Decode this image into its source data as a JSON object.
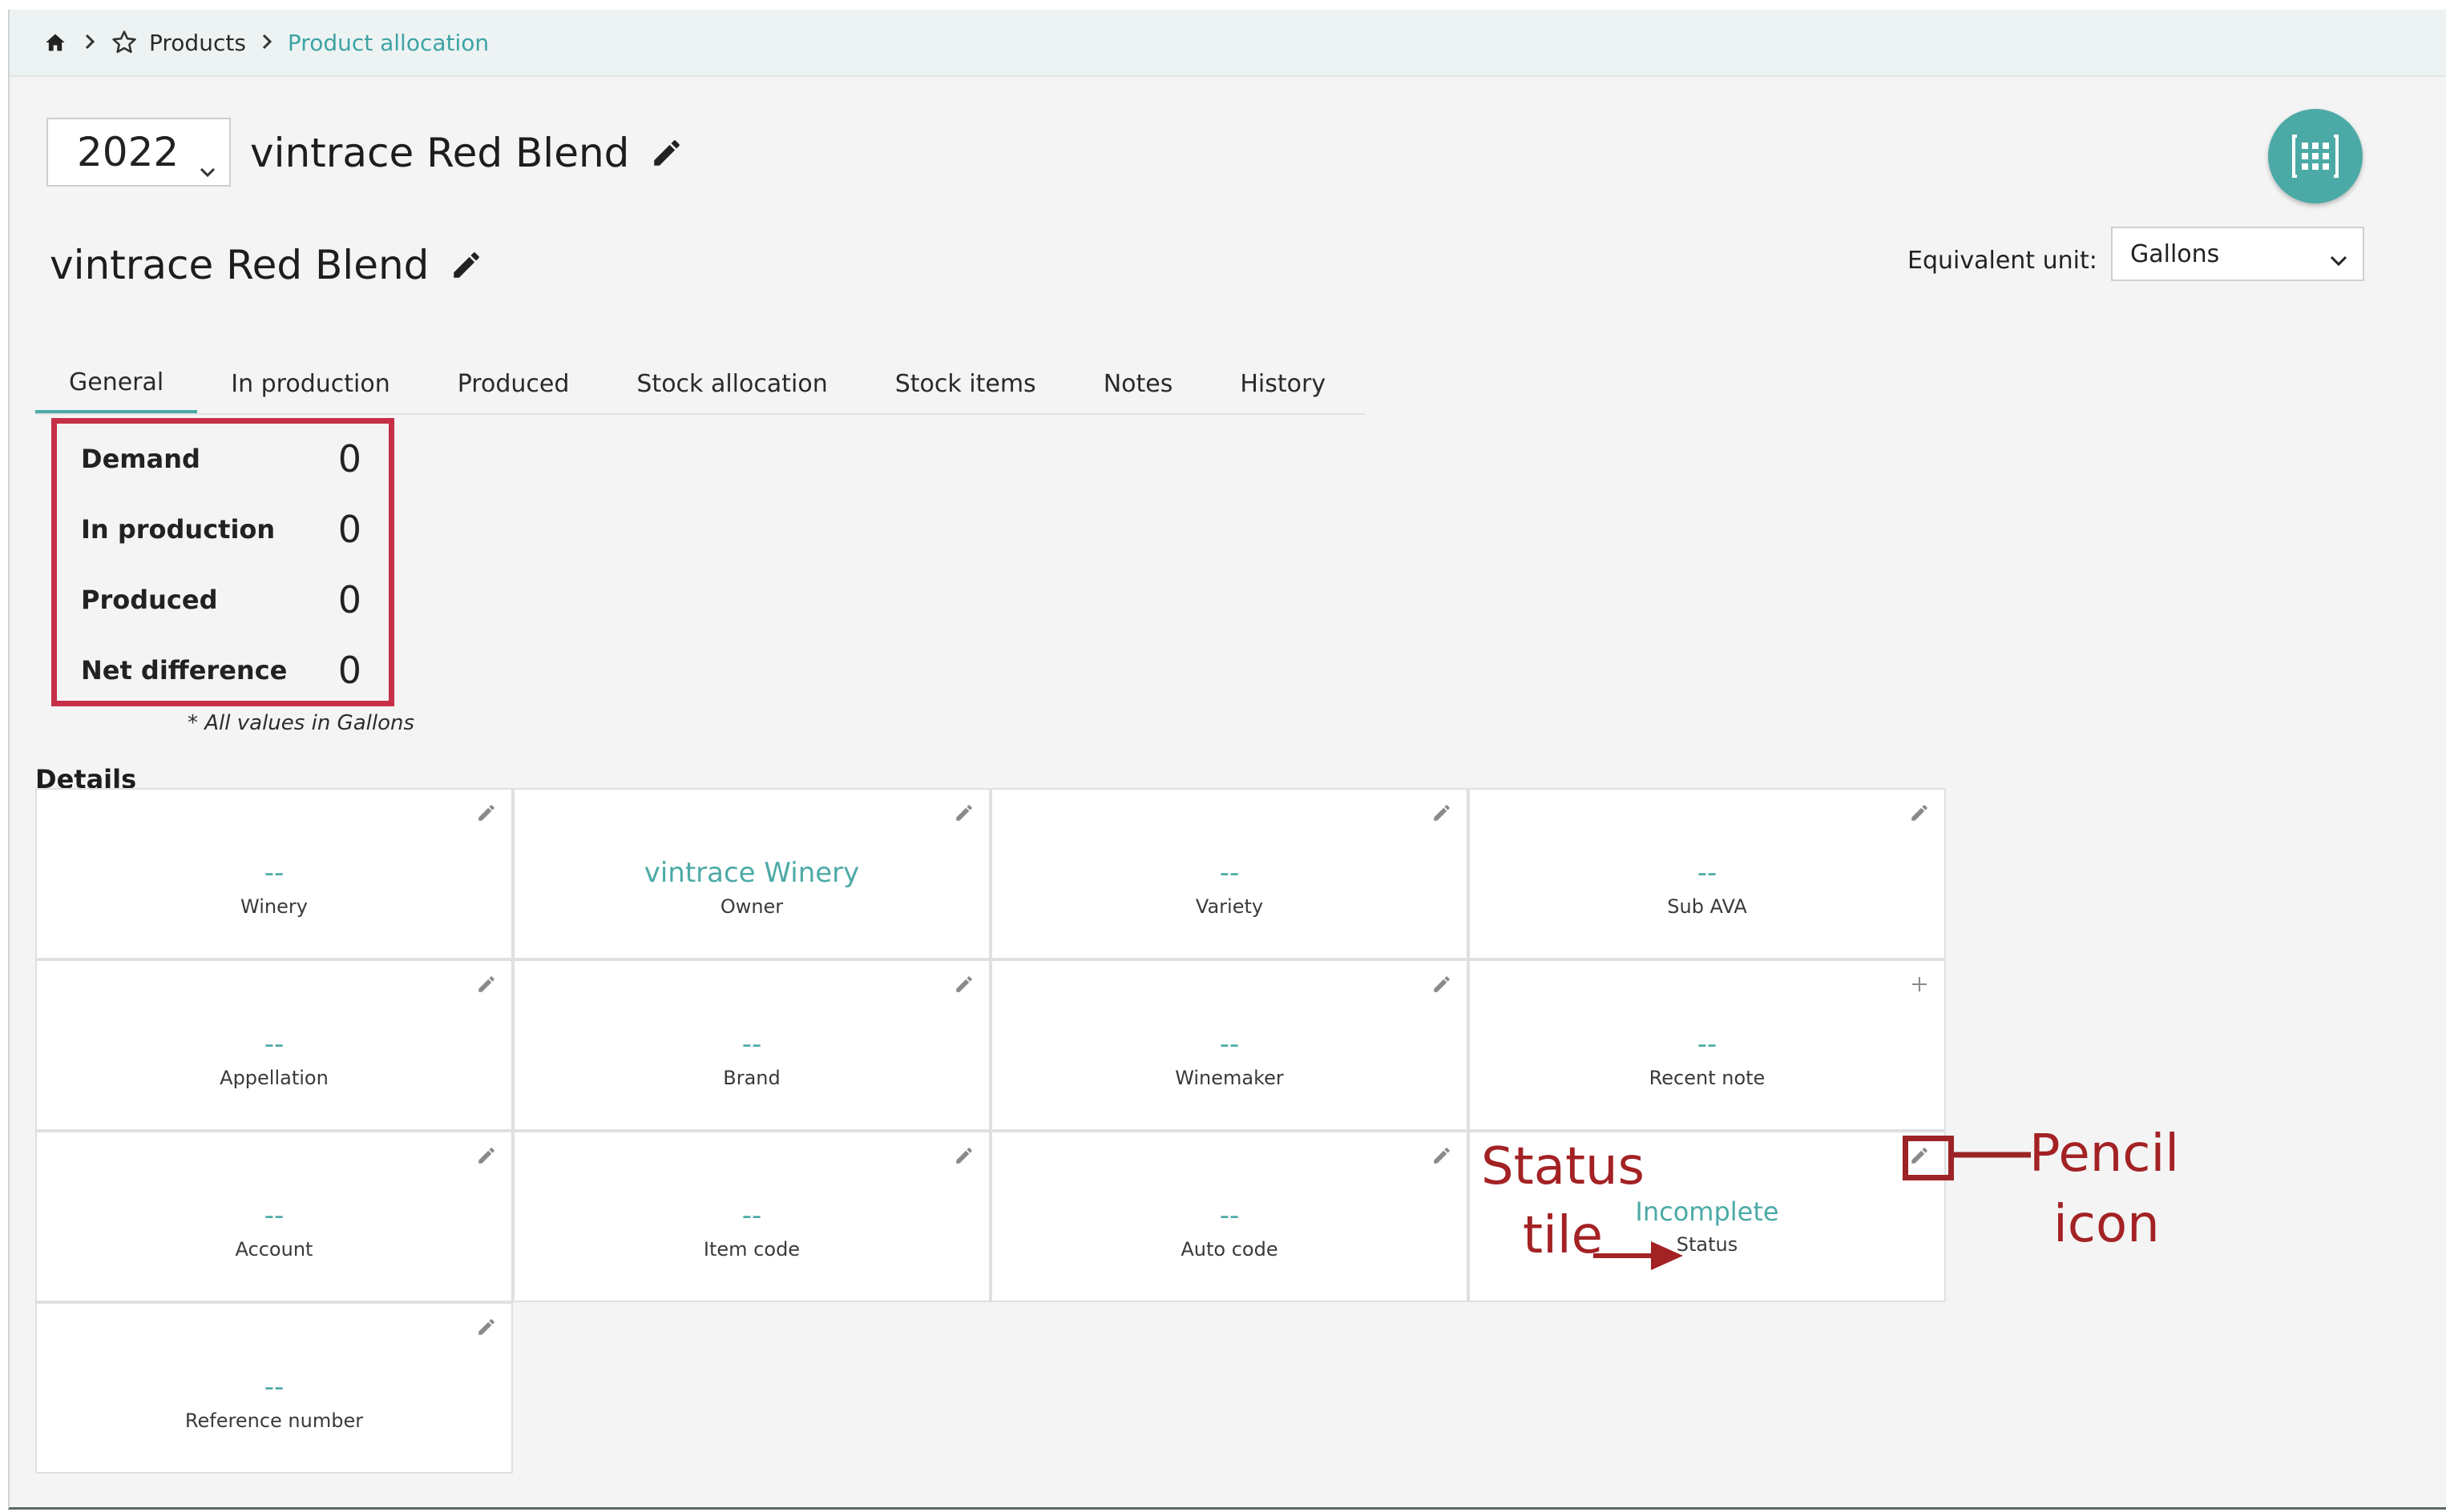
{
  "breadcrumb": {
    "home_icon": "home-icon",
    "star_icon": "star-icon",
    "items": [
      "Products",
      "Product allocation"
    ]
  },
  "header": {
    "year": "2022",
    "title": "vintrace Red Blend",
    "subtitle": "vintrace Red Blend"
  },
  "equivalent_unit": {
    "label": "Equivalent unit:",
    "value": "Gallons"
  },
  "tabs": [
    "General",
    "In production",
    "Produced",
    "Stock allocation",
    "Stock items",
    "Notes",
    "History"
  ],
  "active_tab": "General",
  "summary": {
    "rows": [
      {
        "label": "Demand",
        "value": "0"
      },
      {
        "label": "In production",
        "value": "0"
      },
      {
        "label": "Produced",
        "value": "0"
      },
      {
        "label": "Net difference",
        "value": "0"
      }
    ],
    "note": "* All values in Gallons"
  },
  "details": {
    "heading": "Details",
    "tiles": [
      {
        "value": "--",
        "label": "Winery",
        "action": "edit"
      },
      {
        "value": "vintrace Winery",
        "label": "Owner",
        "action": "edit"
      },
      {
        "value": "--",
        "label": "Variety",
        "action": "edit"
      },
      {
        "value": "--",
        "label": "Sub AVA",
        "action": "edit"
      },
      {
        "value": "--",
        "label": "Appellation",
        "action": "edit"
      },
      {
        "value": "--",
        "label": "Brand",
        "action": "edit"
      },
      {
        "value": "--",
        "label": "Winemaker",
        "action": "edit"
      },
      {
        "value": "--",
        "label": "Recent note",
        "action": "add"
      },
      {
        "value": "--",
        "label": "Account",
        "action": "edit"
      },
      {
        "value": "--",
        "label": "Item code",
        "action": "edit"
      },
      {
        "value": "--",
        "label": "Auto code",
        "action": "edit"
      },
      {
        "value": "Incomplete",
        "label": "Status",
        "action": "edit"
      },
      {
        "value": "--",
        "label": "Reference number",
        "action": "edit"
      }
    ]
  },
  "annotations": {
    "status_tile": [
      "Status",
      "tile"
    ],
    "pencil_icon": [
      "Pencil",
      "icon"
    ]
  },
  "colors": {
    "accent": "#4caaa6",
    "highlight_border": "#c72e47",
    "annotation": "#a32224"
  }
}
